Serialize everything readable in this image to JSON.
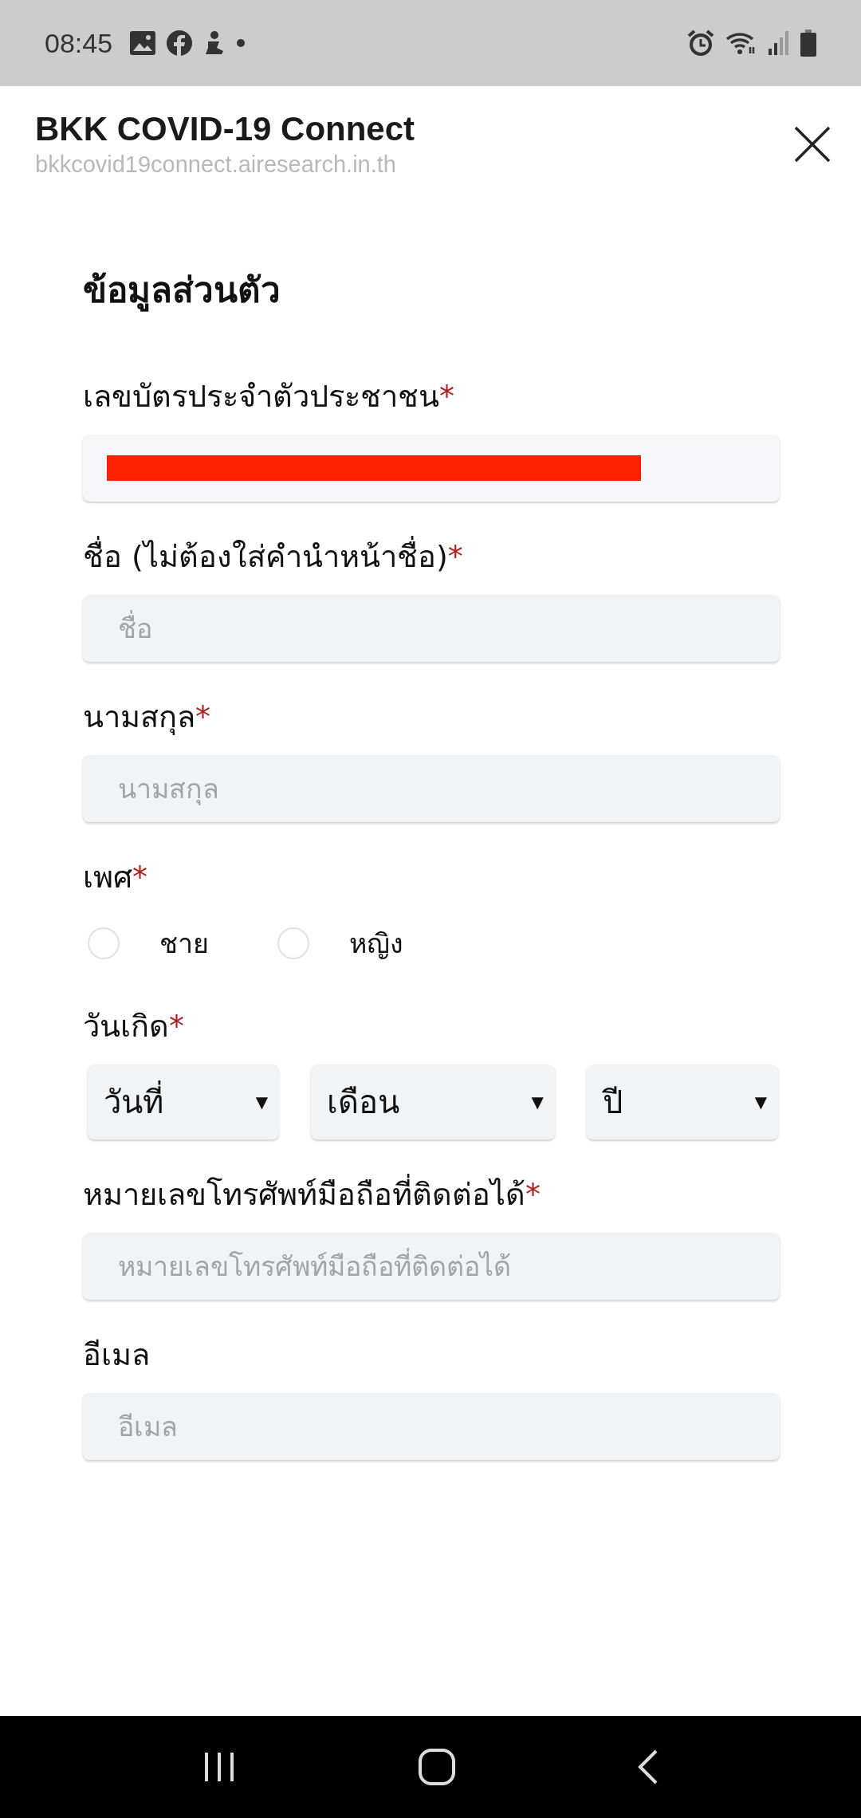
{
  "status_bar": {
    "time": "08:45"
  },
  "header": {
    "title": "BKK COVID-19 Connect",
    "url": "bkkcovid19connect.airesearch.in.th"
  },
  "form": {
    "heading": "ข้อมูลส่วนตัว",
    "fields": [
      {
        "kind": "redacted",
        "label": "เลขบัตรประจำตัวประชาชน",
        "required_mark": "*"
      },
      {
        "kind": "text",
        "label": "ชื่อ (ไม่ต้องใส่คำนำหน้าชื่อ)",
        "required_mark": "*",
        "placeholder": "ชื่อ"
      },
      {
        "kind": "text",
        "label": "นามสกุล",
        "required_mark": "*",
        "placeholder": "นามสกุล"
      },
      {
        "kind": "radio",
        "label": "เพศ",
        "required_mark": "*",
        "options": [
          {
            "label": "ชาย",
            "selected": false
          },
          {
            "label": "หญิง",
            "selected": false
          }
        ]
      },
      {
        "kind": "selects",
        "label": "วันเกิด",
        "required_mark": "*",
        "selects": [
          {
            "value": "วันที่",
            "caret": "▼"
          },
          {
            "value": "เดือน",
            "caret": "▼"
          },
          {
            "value": "ปี",
            "caret": "▼"
          }
        ]
      },
      {
        "kind": "text",
        "label": "หมายเลขโทรศัพท์มือถือที่ติดต่อได้",
        "required_mark": "*",
        "placeholder": "หมายเลขโทรศัพท์มือถือที่ติดต่อได้"
      },
      {
        "kind": "text",
        "label": "อีเมล",
        "placeholder": "อีเมล"
      }
    ]
  }
}
